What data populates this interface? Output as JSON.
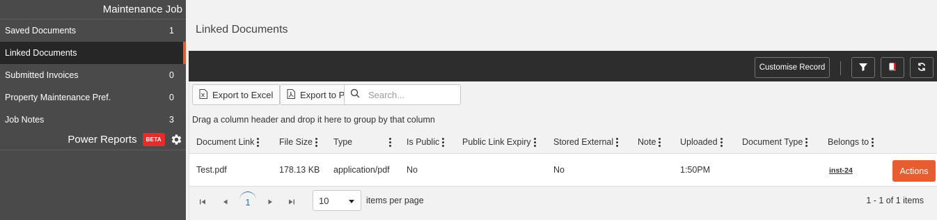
{
  "sidebar": {
    "title": "Maintenance Job",
    "items": [
      {
        "label": "Saved Documents",
        "count": "1"
      },
      {
        "label": "Linked Documents",
        "count": ""
      },
      {
        "label": "Submitted Invoices",
        "count": "0"
      },
      {
        "label": "Property Maintenance Pref.",
        "count": "0"
      },
      {
        "label": "Job Notes",
        "count": "3"
      }
    ],
    "reports_label": "Power Reports",
    "beta_badge": "BETA",
    "settings_icon": "gear-icon"
  },
  "main": {
    "page_title": "Linked Documents",
    "toolbar": {
      "customise_label": "Customise Record",
      "icons": [
        "filter-icon",
        "book-icon",
        "refresh-icon"
      ]
    },
    "grid_toolbar": {
      "export_excel_label": "Export to Excel",
      "export_pdf_label": "Export to PDF",
      "search_placeholder": "Search..."
    },
    "group_hint": "Drag a column header and drop it here to group by that column",
    "columns": [
      "Document Link",
      "File Size",
      "Type",
      "Is Public",
      "Public Link Expiry",
      "Stored External",
      "Note",
      "Uploaded",
      "Document Type",
      "Belongs to"
    ],
    "rows": [
      {
        "document_link": "Test.pdf",
        "file_size": "178.13 KB",
        "type": "application/pdf",
        "is_public": "No",
        "public_link_expiry": "",
        "stored_external": "No",
        "note": "",
        "uploaded": "1:50PM",
        "document_type": "",
        "belongs_to": "inst-24",
        "action_label": "Actions"
      }
    ],
    "pager": {
      "current_page": "1",
      "page_size": "10",
      "items_per_page_label": "items per page",
      "range_text": "1 - 1 of 1 items"
    },
    "colors": {
      "accent": "#e85d2f",
      "sidebar_bg": "#4a4a4a",
      "toolbar_bg": "#2d2d2d",
      "beta_bg": "#e32c2c",
      "link_blue": "#2a6fb0"
    }
  }
}
